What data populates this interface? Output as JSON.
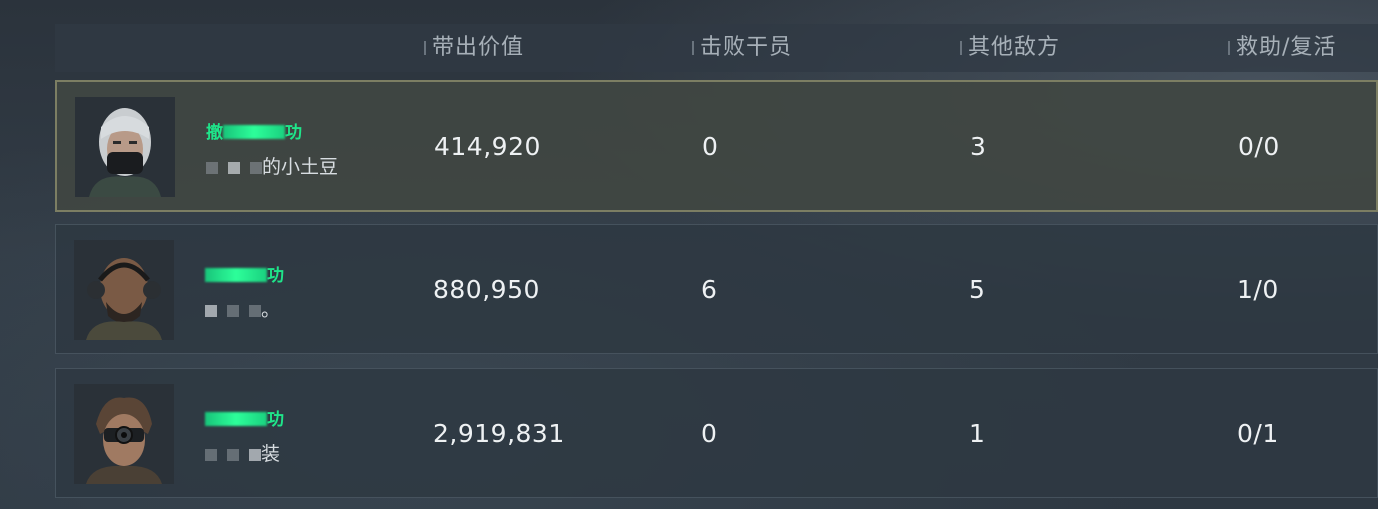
{
  "header": {
    "value": "带出价值",
    "kills": "击败干员",
    "enemies": "其他敌方",
    "assist": "救助/复活"
  },
  "players": [
    {
      "name_prefix": "撤",
      "name_suffix": "功",
      "subtitle": "的小土豆",
      "value": "414,920",
      "kills": "0",
      "enemies": "3",
      "assist": "0/0",
      "highlight": true
    },
    {
      "name_prefix": "",
      "name_suffix": "功",
      "subtitle": "。",
      "value": "880,950",
      "kills": "6",
      "enemies": "5",
      "assist": "1/0",
      "highlight": false
    },
    {
      "name_prefix": "",
      "name_suffix": "功",
      "subtitle": "装",
      "value": "2,919,831",
      "kills": "0",
      "enemies": "1",
      "assist": "0/1",
      "highlight": false
    }
  ],
  "colors": {
    "name_green": "#1fe58a",
    "highlight_border": "#7c7e63"
  }
}
